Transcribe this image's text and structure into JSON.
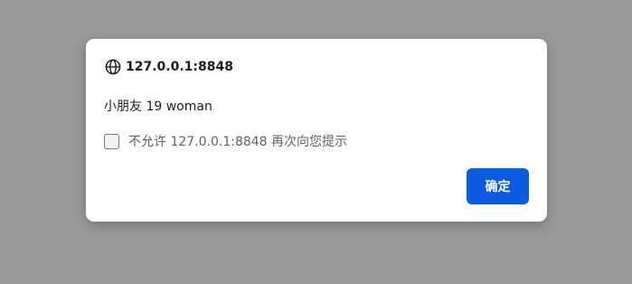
{
  "dialog": {
    "origin": "127.0.0.1:8848",
    "origin_icon": "globe-icon",
    "message": "小朋友 19 woman",
    "checkbox_label": "不允许 127.0.0.1:8848 再次向您提示",
    "checkbox_checked": false,
    "ok_label": "确定"
  },
  "colors": {
    "overlay": "#999a9c",
    "button": "#0b5ce1"
  }
}
